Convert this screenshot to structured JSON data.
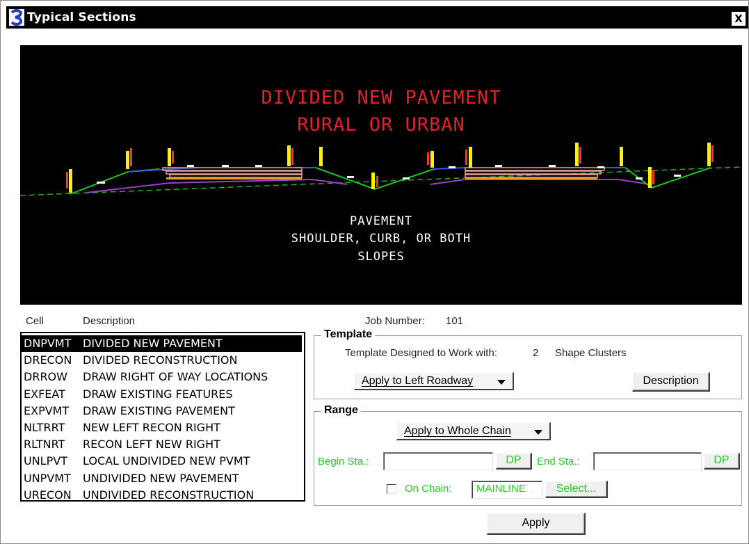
{
  "window": {
    "title": "Typical Sections",
    "close_glyph": "X"
  },
  "preview": {
    "heading_line1": "DIVIDED NEW PAVEMENT",
    "heading_line2": "RURAL OR URBAN",
    "legend_line1": "PAVEMENT",
    "legend_line2": "SHOULDER, CURB, OR BOTH",
    "legend_line3": "SLOPES",
    "colors": {
      "heading": "#e0222b",
      "ground": "#1fb31f",
      "slope": "#22c322",
      "pavement": "#e8a39a",
      "shoulder": "#3b55e0",
      "subbase": "#9a3fd0",
      "label": "#ffef00"
    }
  },
  "list": {
    "col_cell": "Cell",
    "col_description": "Description",
    "items": [
      {
        "code": "DNPVMT",
        "desc": "DIVIDED NEW PAVEMENT",
        "selected": true
      },
      {
        "code": "DRECON",
        "desc": "DIVIDED RECONSTRUCTION"
      },
      {
        "code": "DRROW",
        "desc": "DRAW RIGHT OF WAY LOCATIONS"
      },
      {
        "code": "EXFEAT",
        "desc": "DRAW EXISTING FEATURES"
      },
      {
        "code": "EXPVMT",
        "desc": "DRAW EXISTING PAVEMENT"
      },
      {
        "code": "NLTRRT",
        "desc": "NEW LEFT RECON RIGHT"
      },
      {
        "code": "RLTNRT",
        "desc": "RECON LEFT NEW RIGHT"
      },
      {
        "code": "UNLPVT",
        "desc": "LOCAL UNDIVIDED NEW PVMT"
      },
      {
        "code": "UNPVMT",
        "desc": "UNDIVIDED NEW PAVEMENT"
      },
      {
        "code": "URECON",
        "desc": "UNDIVIDED RECONSTRUCTION"
      }
    ]
  },
  "job": {
    "label": "Job Number:",
    "value": "101"
  },
  "template": {
    "title": "Template",
    "designed_label": "Template Designed to Work with:",
    "designed_count": "2",
    "designed_unit": "Shape Clusters",
    "apply_dropdown": "Apply to Left Roadway",
    "description_button": "Description"
  },
  "range": {
    "title": "Range",
    "apply_dropdown": "Apply to Whole Chain",
    "begin_label": "Begin Sta.:",
    "begin_value": "",
    "dp_label": "DP",
    "end_label": "End Sta.:",
    "end_value": "",
    "on_chain_label": "On  Chain:",
    "on_chain_checked": false,
    "chain_value": "MAINLINE",
    "select_button": "Select..."
  },
  "apply_button": "Apply"
}
